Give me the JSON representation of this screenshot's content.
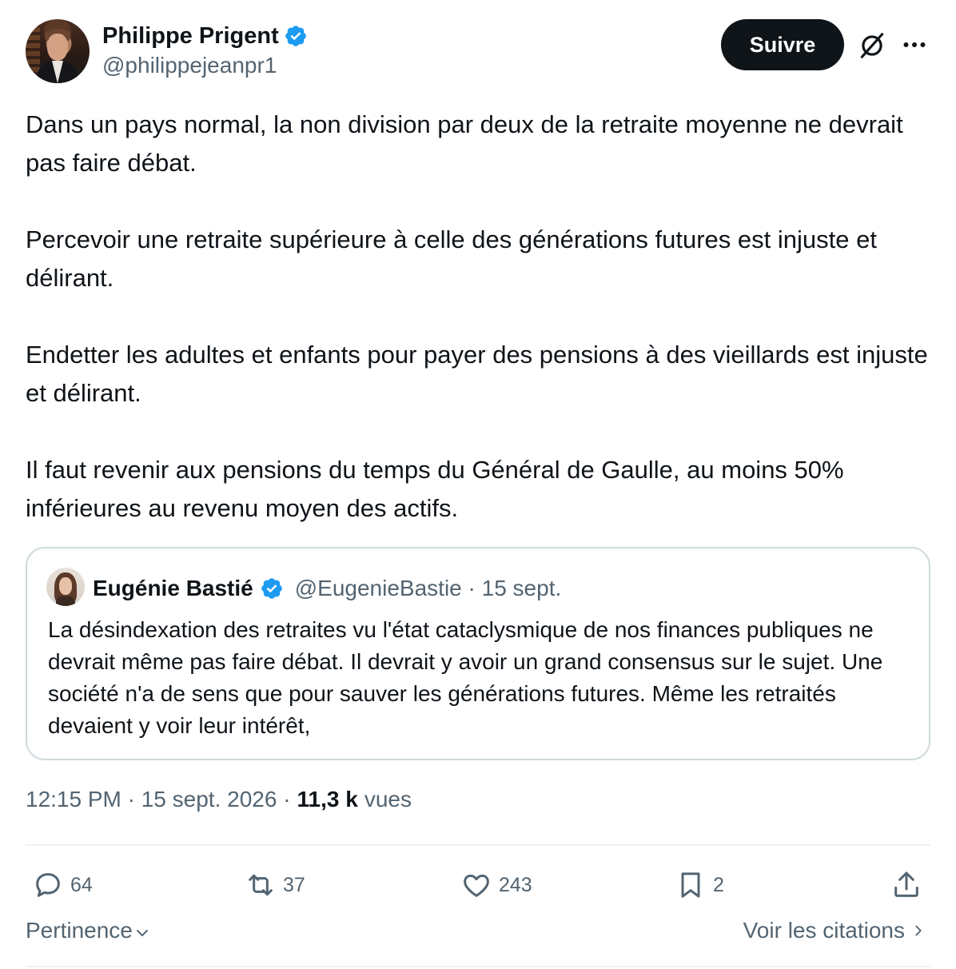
{
  "author": {
    "name": "Philippe Prigent",
    "handle": "@philippejeanpr1",
    "follow_label": "Suivre"
  },
  "tweet": {
    "paragraphs": [
      "Dans un pays normal, la non division par deux de la retraite moyenne ne devrait pas faire débat.",
      "Percevoir une retraite supérieure à celle des générations futures est injuste et délirant.",
      "Endetter les adultes et enfants pour payer des pensions à des vieillards est injuste et délirant.",
      "Il faut revenir aux pensions du temps du Général de Gaulle, au moins 50% inférieures au revenu moyen des actifs."
    ]
  },
  "quote": {
    "name": "Eugénie Bastié",
    "meta": "@EugenieBastie · 15 sept.",
    "text": "La désindexation des retraites vu l'état cataclysmique de nos finances publiques ne devrait même pas faire débat. Il devrait y avoir un grand consensus sur le sujet. Une société n'a de sens que pour sauver les générations futures. Même les retraités devaient y voir leur intérêt,"
  },
  "meta": {
    "time_date": "12:15 PM · 15 sept. 2026 ·",
    "views_count": "11,3 k",
    "views_label": "vues"
  },
  "actions": {
    "replies": "64",
    "reposts": "37",
    "likes": "243",
    "bookmarks": "2"
  },
  "footer": {
    "sort_label": "Pertinence",
    "quotes_label": "Voir les citations"
  },
  "colors": {
    "text": "#0f1419",
    "secondary": "#536471",
    "verified": "#1d9bf0",
    "border": "#cfd9de"
  }
}
